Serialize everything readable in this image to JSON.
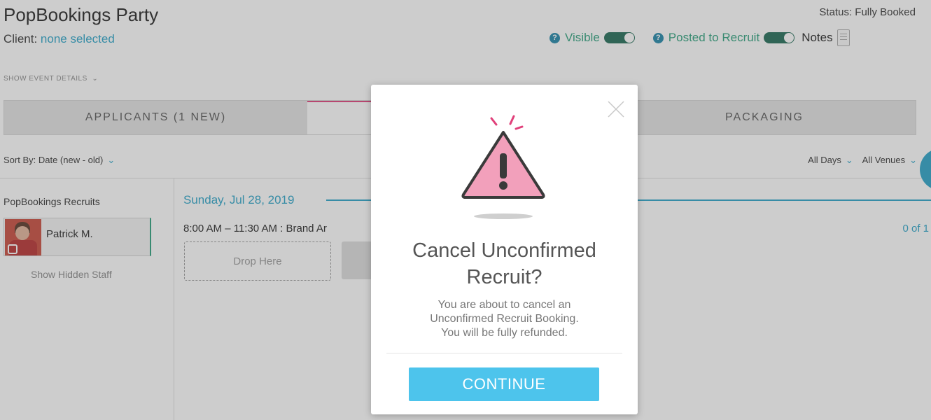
{
  "header": {
    "title": "PopBookings Party",
    "client_label": "Client:",
    "client_value": "none selected",
    "status": "Status: Fully Booked",
    "help_glyph": "?",
    "visible_label": "Visible",
    "posted_label": "Posted to Recruit",
    "notes_label": "Notes",
    "show_details": "SHOW EVENT DETAILS"
  },
  "tabs": [
    {
      "label": "APPLICANTS (1 NEW)"
    },
    {
      "label": ""
    },
    {
      "label": "PACKAGING"
    }
  ],
  "filters": {
    "sort_by": "Sort By: Date (new - old)",
    "days": "All Days",
    "venues": "All Venues"
  },
  "left": {
    "heading": "PopBookings Recruits",
    "staff": [
      {
        "name": "Patrick M."
      }
    ],
    "show_hidden": "Show Hidden Staff"
  },
  "main": {
    "date": "Sunday, Jul 28, 2019",
    "shift": "8:00 AM – 11:30 AM  : Brand Ar",
    "drop_here": "Drop Here",
    "count": "0 of 1"
  },
  "modal": {
    "title_line1": "Cancel Unconfirmed",
    "title_line2": "Recruit?",
    "body_line1": "You are about to cancel an",
    "body_line2": "Unconfirmed Recruit Booking.",
    "body_line3": "You will be fully refunded.",
    "continue_label": "CONTINUE"
  },
  "colors": {
    "accent_blue": "#29a3c7",
    "green": "#2ba07b",
    "pink": "#e0407a",
    "button": "#4dc4ec"
  }
}
